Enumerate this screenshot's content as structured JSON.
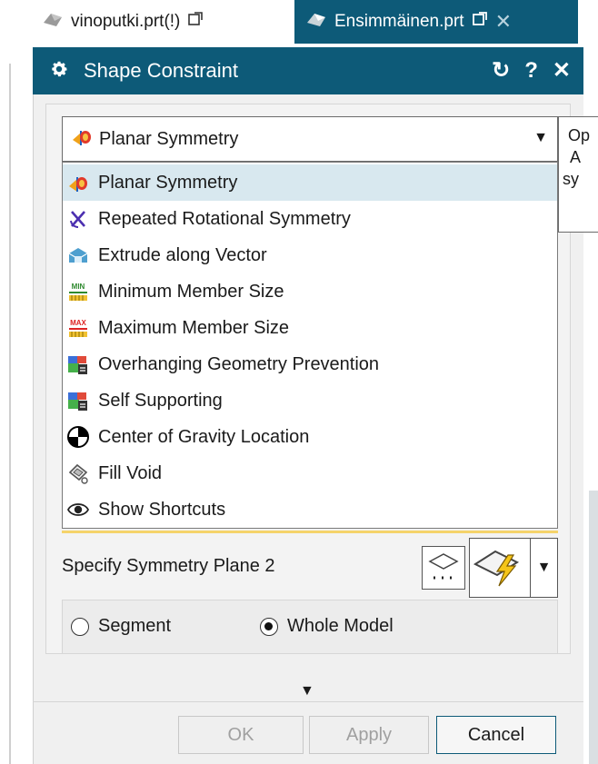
{
  "tabs": [
    {
      "label": "vinoputki.prt(!)",
      "active": false
    },
    {
      "label": "Ensimmäinen.prt",
      "active": true
    }
  ],
  "dialog": {
    "title": "Shape Constraint",
    "accent_color": "#0d5a78"
  },
  "type_select": {
    "selected_label": "Planar Symmetry"
  },
  "tooltip": {
    "lines": [
      "Op",
      "A",
      "sy"
    ]
  },
  "dropdown": {
    "options": [
      {
        "label": "Planar Symmetry",
        "icon": "planar-symmetry-icon",
        "selected": true
      },
      {
        "label": "Repeated Rotational Symmetry",
        "icon": "rotational-symmetry-icon",
        "selected": false
      },
      {
        "label": "Extrude along Vector",
        "icon": "extrude-icon",
        "selected": false
      },
      {
        "label": "Minimum Member Size",
        "icon": "min-member-size-icon",
        "selected": false
      },
      {
        "label": "Maximum Member Size",
        "icon": "max-member-size-icon",
        "selected": false
      },
      {
        "label": "Overhanging Geometry Prevention",
        "icon": "overhang-prevention-icon",
        "selected": false
      },
      {
        "label": "Self Supporting",
        "icon": "self-supporting-icon",
        "selected": false
      },
      {
        "label": "Center of Gravity Location",
        "icon": "center-of-gravity-icon",
        "selected": false
      },
      {
        "label": "Fill Void",
        "icon": "fill-void-icon",
        "selected": false
      },
      {
        "label": "Show Shortcuts",
        "icon": "eye-icon",
        "selected": false
      }
    ]
  },
  "icon_text": {
    "min": "MIN",
    "max": "MAX"
  },
  "plane": {
    "label": "Specify Symmetry Plane 2"
  },
  "scope": {
    "options": [
      {
        "label": "Segment",
        "checked": false
      },
      {
        "label": "Whole Model",
        "checked": true
      }
    ]
  },
  "buttons": {
    "ok": "OK",
    "apply": "Apply",
    "cancel": "Cancel"
  }
}
